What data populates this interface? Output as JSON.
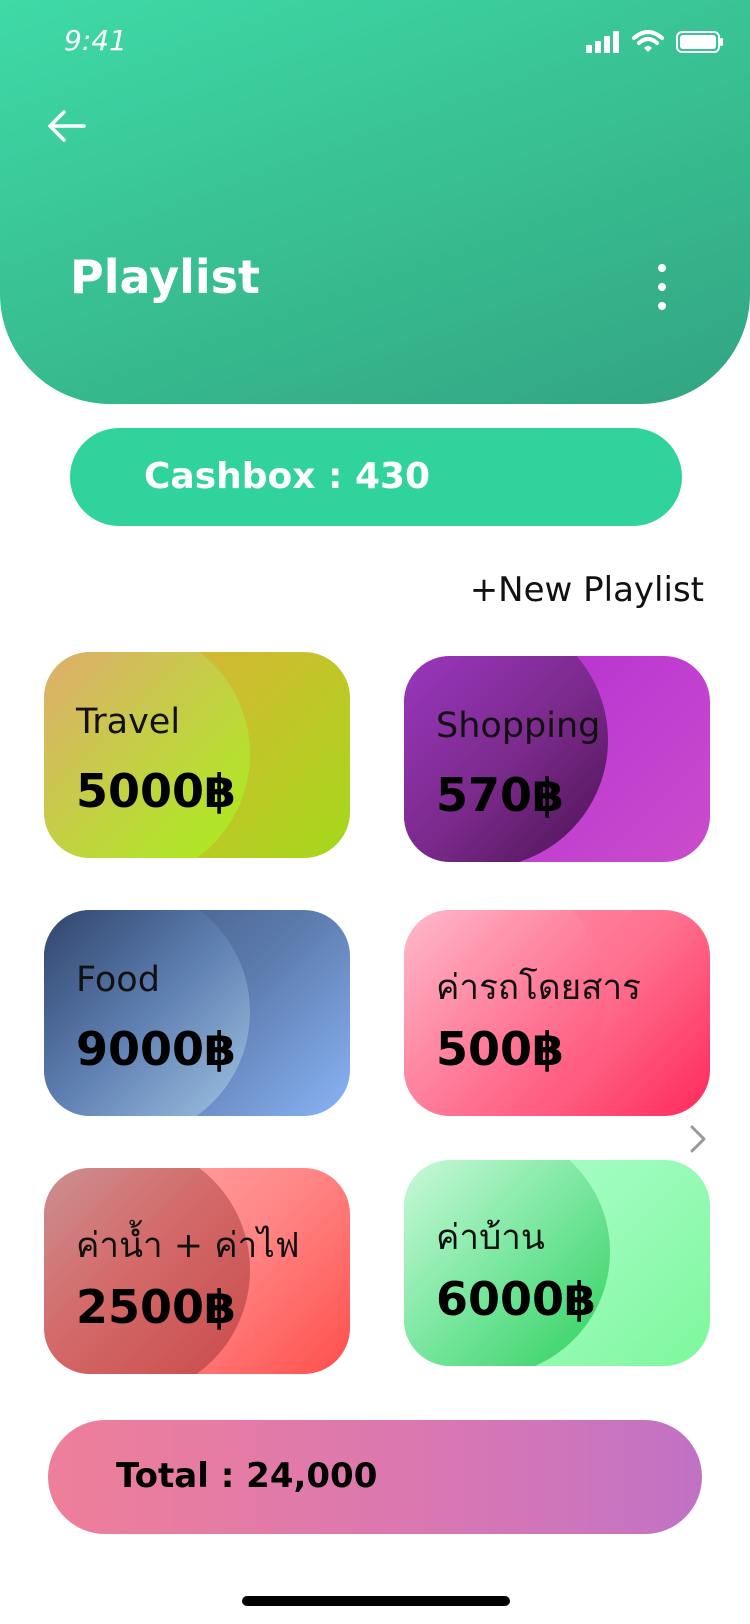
{
  "status_bar": {
    "time": "9:41"
  },
  "header": {
    "title": "Playlist"
  },
  "cashbox": {
    "label": "Cashbox : 430"
  },
  "actions": {
    "new_playlist": "+New Playlist"
  },
  "playlists": [
    {
      "name": "Travel",
      "amount": "5000฿"
    },
    {
      "name": "Shopping",
      "amount": "570฿"
    },
    {
      "name": "Food",
      "amount": "9000฿"
    },
    {
      "name": "ค่ารถโดยสาร",
      "amount": "500฿"
    },
    {
      "name": "ค่าน้ำ + ค่าไฟ",
      "amount": "2500฿"
    },
    {
      "name": "ค่าบ้าน",
      "amount": "6000฿"
    }
  ],
  "footer": {
    "total": "Total : 24,000"
  },
  "colors": {
    "header_green": "#37ba8e",
    "cashbox_green": "#2fd39b",
    "total_pink": "#d977b2"
  }
}
